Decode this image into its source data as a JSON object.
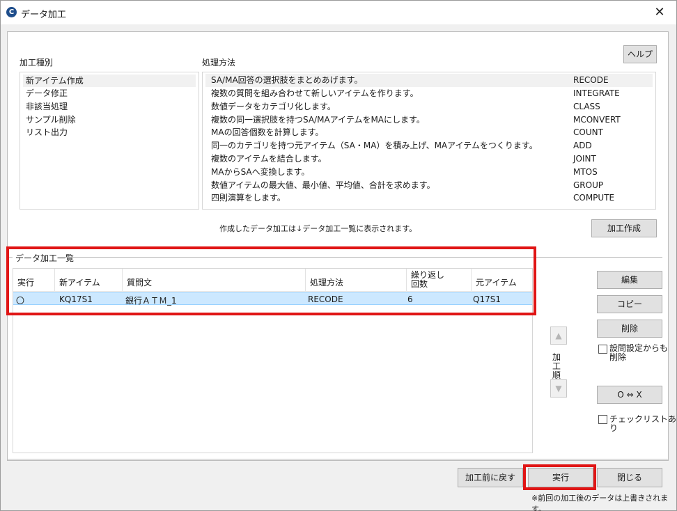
{
  "window": {
    "title": "データ加工",
    "close_glyph": "✕",
    "app_icon": "C"
  },
  "help_button": "ヘルプ",
  "category": {
    "label": "加工種別",
    "items": [
      "新アイテム作成",
      "データ修正",
      "非該当処理",
      "サンプル削除",
      "リスト出力"
    ],
    "selected_index": 0
  },
  "method": {
    "label": "処理方法",
    "items": [
      {
        "desc": "SA/MA回答の選択肢をまとめあげます。",
        "code": "RECODE"
      },
      {
        "desc": "複数の質問を組み合わせて新しいアイテムを作ります。",
        "code": "INTEGRATE"
      },
      {
        "desc": "数値データをカテゴリ化します。",
        "code": "CLASS"
      },
      {
        "desc": "複数の同一選択肢を持つSA/MAアイテムをMAにします。",
        "code": "MCONVERT"
      },
      {
        "desc": "MAの回答個数を計算します。",
        "code": "COUNT"
      },
      {
        "desc": "同一のカテゴリを持つ元アイテム（SA・MA）を積み上げ、MAアイテムをつくります。",
        "code": "ADD"
      },
      {
        "desc": "複数のアイテムを結合します。",
        "code": "JOINT"
      },
      {
        "desc": "MAからSAへ変換します。",
        "code": "MTOS"
      },
      {
        "desc": "数値アイテムの最大値、最小値、平均値、合計を求めます。",
        "code": "GROUP"
      },
      {
        "desc": "四則演算をします。",
        "code": "COMPUTE"
      }
    ],
    "selected_index": 0
  },
  "note": "作成したデータ加工は↓データ加工一覧に表示されます。",
  "create_button": "加工作成",
  "list": {
    "label": "データ加工一覧",
    "columns": [
      "実行",
      "新アイテム",
      "質問文",
      "処理方法",
      "繰り返し\n回数",
      "元アイテム"
    ],
    "column_lines": {
      "repeat_1": "繰り返し",
      "repeat_2": "回数"
    },
    "rows": [
      {
        "run": "〇",
        "new_item": "KQ17S1",
        "question": "銀行ＡＴＭ_1",
        "method": "RECODE",
        "repeat": "6",
        "source": "Q17S1"
      }
    ]
  },
  "side_buttons": {
    "edit": "編集",
    "copy": "コピー",
    "delete": "削除",
    "toggle": "O ⇔ X"
  },
  "order": {
    "label_1": "加工",
    "label_2": "順",
    "up_glyph": "▲",
    "down_glyph": "▼"
  },
  "checkboxes": {
    "delete_from_settings_1": "設問設定からも",
    "delete_from_settings_2": "削除",
    "checklist": "チェックリストあり"
  },
  "footer": {
    "revert_button": "加工前に戻す",
    "run_button": "実行",
    "close_button": "閉じる",
    "warning": "※前回の加工後のデータは上書きされます。"
  },
  "colors": {
    "highlight": "#e01515",
    "selection": "#cce8ff",
    "app_icon": "#1f4e8c"
  }
}
